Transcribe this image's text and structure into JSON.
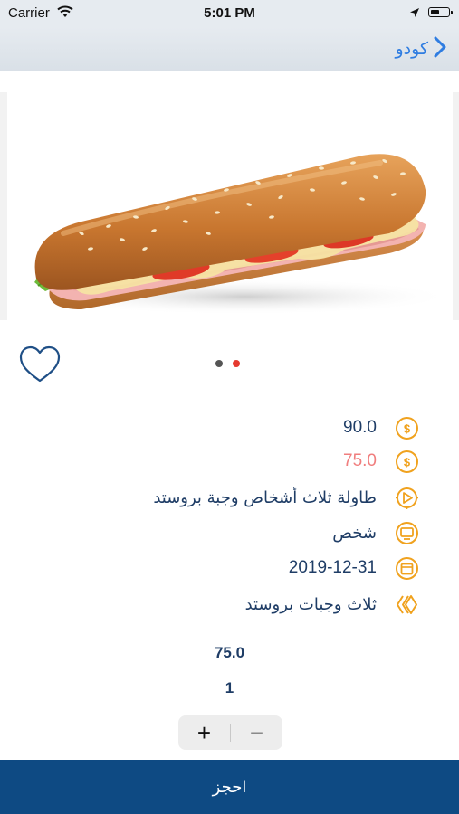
{
  "status_bar": {
    "carrier": "Carrier",
    "time": "5:01 PM"
  },
  "nav": {
    "back_label": "كودو",
    "icon": "chevron-right-icon"
  },
  "hero": {
    "image": "sandwich-photo",
    "carousel_active_index": 1,
    "carousel_count": 2
  },
  "colors": {
    "accent": "#f0a21e",
    "brand": "#0e4a83",
    "text": "#1f3d66",
    "sale": "#f07e7e",
    "link": "#2f7de1"
  },
  "details": {
    "price": "90.0",
    "sale_price": "75.0",
    "title": "طاولة ثلاث أشخاص وجبة بروستد",
    "unit": "شخص",
    "date": "2019-12-31",
    "description": "ثلاث وجبات بروستد"
  },
  "order": {
    "total": "75.0",
    "quantity": "1",
    "plus": "+",
    "minus": "−"
  },
  "book_label": "احجز"
}
